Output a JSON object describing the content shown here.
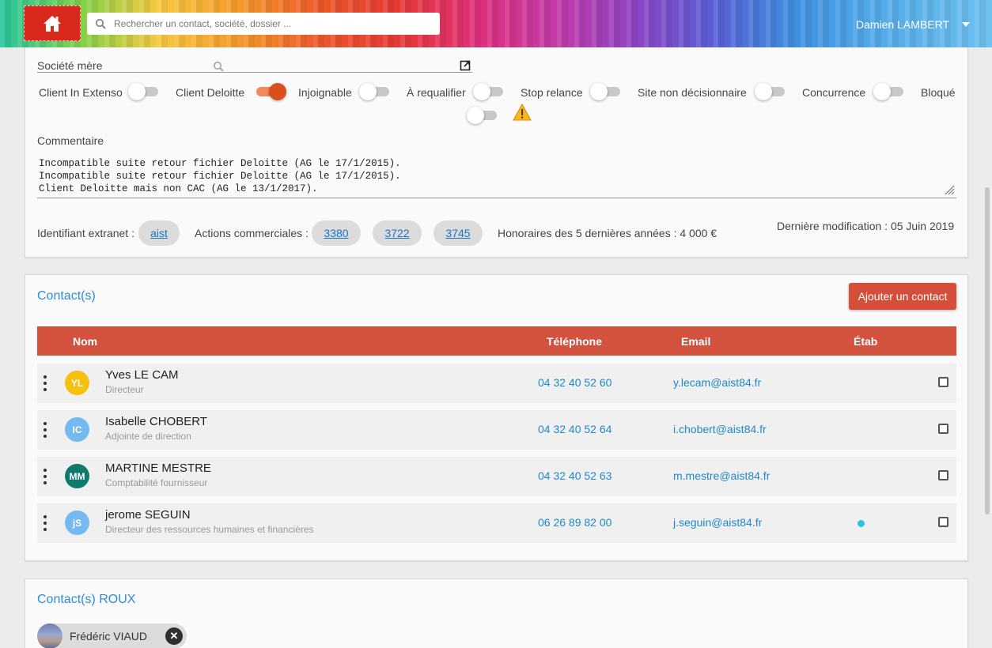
{
  "header": {
    "search_placeholder": "Rechercher un contact, société, dossier ...",
    "user_name": "Damien LAMBERT"
  },
  "company": {
    "societe_mere_label": "Société mère",
    "toggles": [
      {
        "label": "Client In Extenso",
        "on": false
      },
      {
        "label": "Client Deloitte",
        "on": true
      },
      {
        "label": "Injoignable",
        "on": false
      },
      {
        "label": "À requalifier",
        "on": false
      },
      {
        "label": "Stop relance",
        "on": false
      },
      {
        "label": "Site non décisionnaire",
        "on": false
      },
      {
        "label": "Concurrence",
        "on": false
      },
      {
        "label": "Bloqué",
        "on": false
      }
    ],
    "comment_label": "Commentaire",
    "comment_text": "Incompatible suite retour fichier Deloitte (AG le 17/1/2015).\nIncompatible suite retour fichier Deloitte (AG le 17/1/2015).\nClient Deloitte mais non CAC (AG le 13/1/2017).",
    "extranet_label": "Identifiant extranet :",
    "extranet_id": "aist",
    "actions_label": "Actions commerciales :",
    "actions": [
      "3380",
      "3722",
      "3745"
    ],
    "honoraires": "Honoraires des 5 dernières années : 4 000 €",
    "last_modified": "Dernière modification : 05 Juin 2019"
  },
  "contacts": {
    "title": "Contact(s)",
    "add_button": "Ajouter un contact",
    "columns": {
      "name": "Nom",
      "phone": "Téléphone",
      "email": "Email",
      "etab": "Étab"
    },
    "rows": [
      {
        "initials": "YL",
        "avatar_color": "#f5c010",
        "name": "Yves LE CAM",
        "role": "Directeur",
        "phone": "04 32 40 52 60",
        "email": "y.lecam@aist84.fr",
        "etab": false
      },
      {
        "initials": "IC",
        "avatar_color": "#74b9f0",
        "name": "Isabelle CHOBERT",
        "role": "Adjointe de direction",
        "phone": "04 32 40 52 64",
        "email": "i.chobert@aist84.fr",
        "etab": false
      },
      {
        "initials": "MM",
        "avatar_color": "#0e7a6e",
        "name": "MARTINE MESTRE",
        "role": "Comptabilité fournisseur",
        "phone": "04 32 40 52 63",
        "email": "m.mestre@aist84.fr",
        "etab": false
      },
      {
        "initials": "jS",
        "avatar_color": "#74b9f0",
        "name": "jerome SEGUIN",
        "role": "Directeur des ressources humaines et financières",
        "phone": "06 26 89 82 00",
        "email": "j.seguin@aist84.fr",
        "etab": true
      }
    ]
  },
  "roux": {
    "title": "Contact(s) ROUX",
    "person": "Frédéric VIAUD"
  }
}
